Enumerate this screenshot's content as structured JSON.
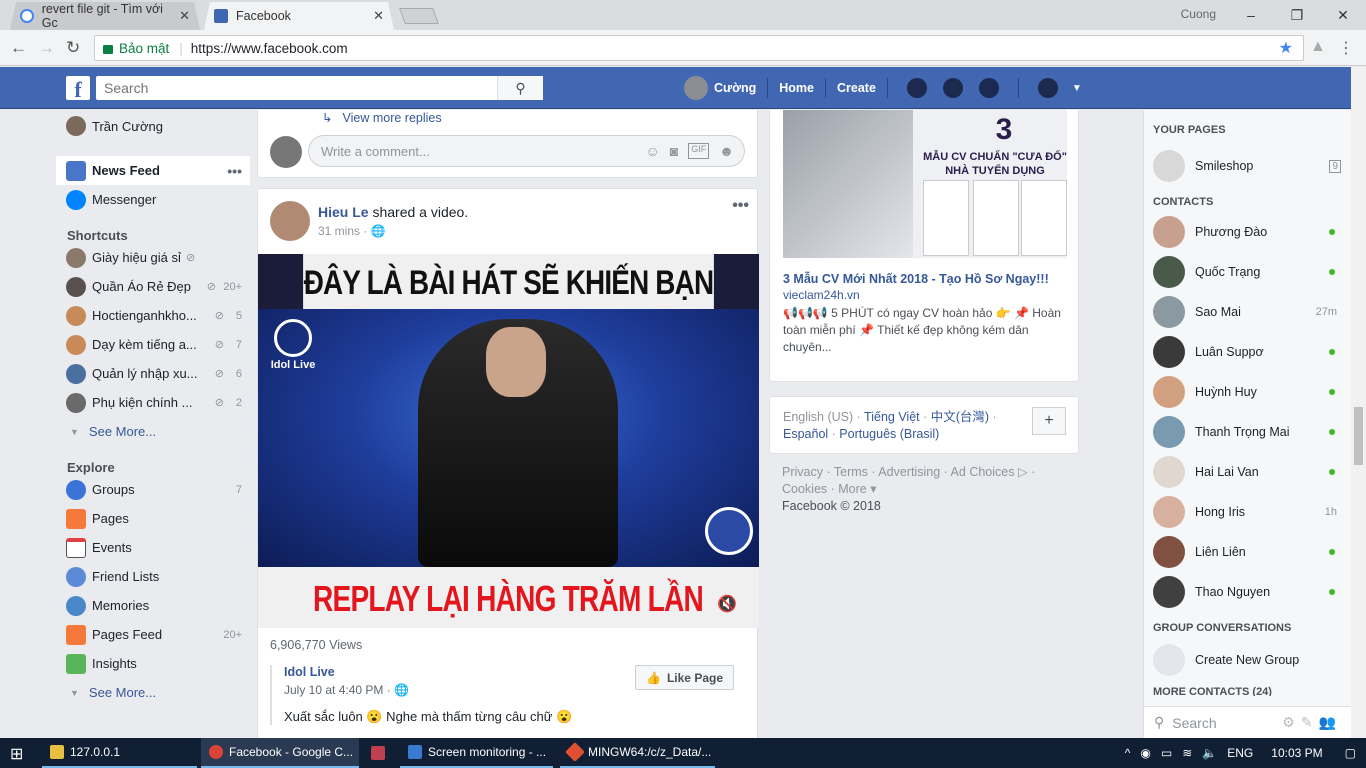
{
  "browser": {
    "tabs": [
      {
        "title": "revert file git - Tìm với Gc"
      },
      {
        "title": "Facebook"
      }
    ],
    "user_chip": "Cuong",
    "secure_label": "Bảo mật",
    "url": "https://www.facebook.com"
  },
  "fb_header": {
    "search_placeholder": "Search",
    "profile_name": "Cường",
    "home": "Home",
    "create": "Create"
  },
  "left_nav": {
    "profile": "Trần Cường",
    "news_feed": "News Feed",
    "messenger": "Messenger",
    "shortcuts_title": "Shortcuts",
    "shortcuts": [
      {
        "label": "Giày hiệu giá sỉ",
        "count": ""
      },
      {
        "label": "Quần Áo Rẻ Đẹp",
        "count": "20+"
      },
      {
        "label": "Hoctienganhkho...",
        "count": "5"
      },
      {
        "label": "Dạy kèm tiếng a...",
        "count": "7"
      },
      {
        "label": "Quản lý nhập xu...",
        "count": "6"
      },
      {
        "label": "Phụ kiện chính ...",
        "count": "2"
      }
    ],
    "see_more": "See More...",
    "explore_title": "Explore",
    "explore": [
      {
        "label": "Groups",
        "count": "7"
      },
      {
        "label": "Pages",
        "count": ""
      },
      {
        "label": "Events",
        "count": ""
      },
      {
        "label": "Friend Lists",
        "count": ""
      },
      {
        "label": "Memories",
        "count": ""
      },
      {
        "label": "Pages Feed",
        "count": "20+"
      },
      {
        "label": "Insights",
        "count": ""
      }
    ],
    "see_more_2": "See More..."
  },
  "feed": {
    "view_more_replies": "View more replies",
    "comment_placeholder": "Write a comment...",
    "post": {
      "author": "Hieu Le",
      "action": "shared a video.",
      "time": "31 mins ·",
      "video_top_text": "ĐÂY LÀ BÀI HÁT SẼ KHIẾN BẠN",
      "video_bottom_text": "REPLAY LẠI HÀNG TRĂM LẦN",
      "video_logo": "Idol Live",
      "views": "6,906,770 Views",
      "shared_page": "Idol Live",
      "shared_time": "July 10 at 4:40 PM ·",
      "like_page": "Like Page",
      "shared_text": "Xuất sắc luôn 😮 Nghe mà thấm từng câu chữ 😮"
    }
  },
  "right_col": {
    "ad_image_big": "3",
    "ad_image_text": "MẪU CV CHUẨN \"CƯA ĐỔ\" NHÀ TUYỂN DỤNG",
    "ad_title": "3 Mẫu CV Mới Nhất 2018 - Tạo Hồ Sơ Ngay!!!",
    "ad_url": "vieclam24h.vn",
    "ad_text": "📢📢📢 5 PHÚT có ngay CV hoàn hảo 👉 📌 Hoàn toàn miễn phí 📌 Thiết kế đẹp không kém dân chuyên...",
    "lang_current": "English (US) ·",
    "langs": [
      "Tiếng Việt",
      "中文(台灣)",
      "Español",
      "Português (Brasil)"
    ],
    "footer_links": "Privacy · Terms · Advertising · Ad Choices ▷ · Cookies · More ▾",
    "copyright": "Facebook © 2018"
  },
  "chat": {
    "your_pages": "YOUR PAGES",
    "page_name": "Smileshop",
    "page_badge": "9",
    "contacts_title": "CONTACTS",
    "contacts": [
      {
        "name": "Phương Đào",
        "status": ""
      },
      {
        "name": "Quốc Trạng",
        "status": ""
      },
      {
        "name": "Sao Mai",
        "status": "27m"
      },
      {
        "name": "Luân Suppơ",
        "status": ""
      },
      {
        "name": "Huỳnh Huy",
        "status": ""
      },
      {
        "name": "Thanh Trọng Mai",
        "status": ""
      },
      {
        "name": "Hai Lai Van",
        "status": ""
      },
      {
        "name": "Hong Iris",
        "status": "1h"
      },
      {
        "name": "Liên Liên",
        "status": ""
      },
      {
        "name": "Thao Nguyen",
        "status": ""
      }
    ],
    "group_conv": "GROUP CONVERSATIONS",
    "create_group": "Create New Group",
    "more_contacts": "MORE CONTACTS (24)",
    "search_placeholder": "Search"
  },
  "taskbar": {
    "items": [
      "127.0.0.1",
      "Facebook - Google C...",
      "Screen monitoring - ...",
      "MINGW64:/c/z_Data/..."
    ],
    "lang": "ENG",
    "time": "10:03 PM"
  },
  "colors": {
    "fb_blue": "#4267b2",
    "link": "#365899",
    "online": "#42b72a"
  }
}
